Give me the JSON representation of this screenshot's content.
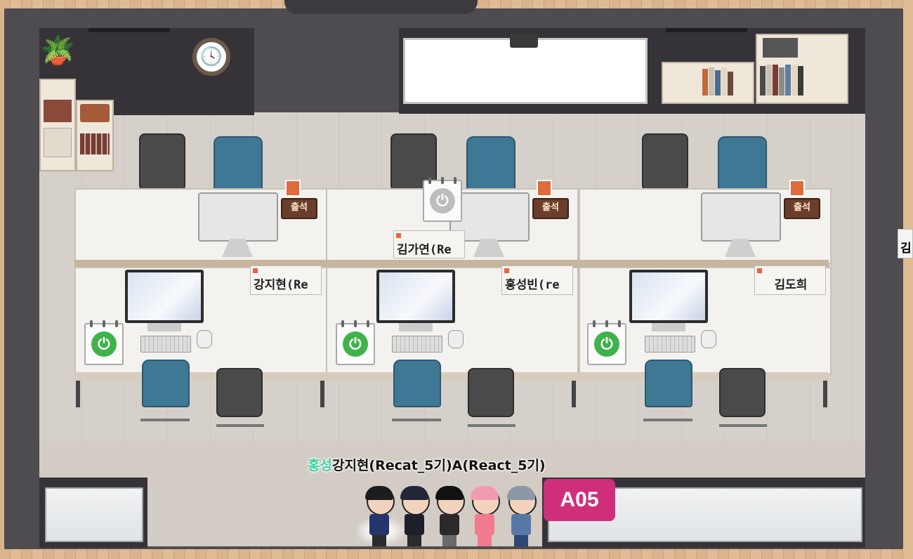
{
  "room": {
    "zone_label": "A05"
  },
  "desks": {
    "back_row": [
      {
        "attendance_label": "출석"
      },
      {
        "attendance_label": "출석"
      },
      {
        "attendance_label": "출석"
      }
    ],
    "name_plates": [
      {
        "name": "김가연(Re"
      },
      {
        "name": "강지현(Re"
      },
      {
        "name": "홍성빈(re"
      },
      {
        "name": "김도희"
      }
    ],
    "edge_plate": "김"
  },
  "players_overlay": {
    "highlight": "홍성",
    "text": "강지현(Recat_5기)A(React_5기)"
  },
  "colors": {
    "badge": "#cf2f7a",
    "power_on": "#3fb34a",
    "chair_blue": "#3f7895"
  },
  "icons": [
    "power-icon",
    "clock-icon",
    "projector-icon",
    "plant-icon",
    "person-icon"
  ]
}
